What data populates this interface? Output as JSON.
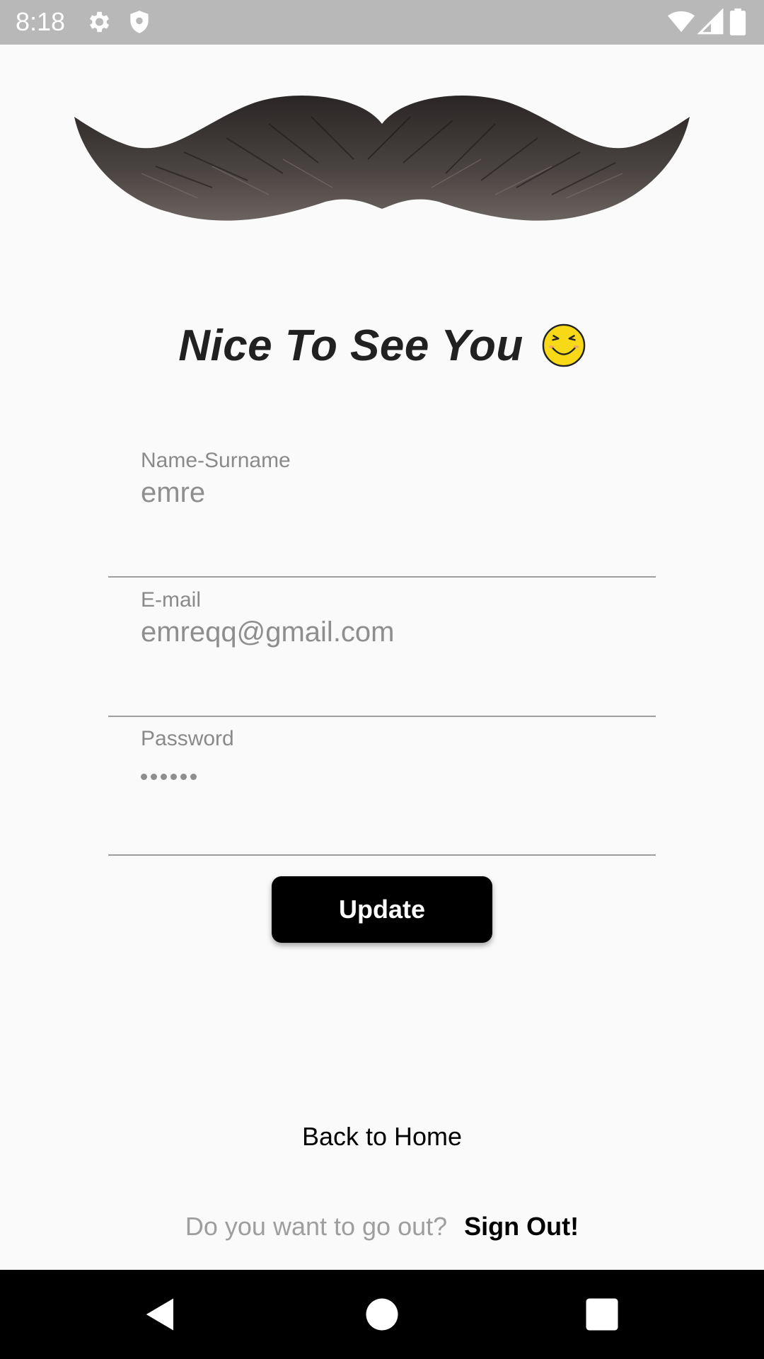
{
  "status_bar": {
    "time": "8:18",
    "icons": [
      "settings-icon",
      "shield-icon",
      "wifi-icon",
      "signal-icon",
      "battery-icon"
    ]
  },
  "header": {
    "title": "Nice To See You",
    "emoji_icon": "laughing-smiley-icon"
  },
  "form": {
    "name_label": "Name-Surname",
    "name_value": "emre",
    "email_label": "E-mail",
    "email_value": "emreqq@gmail.com",
    "password_label": "Password",
    "password_length": 6
  },
  "actions": {
    "update_label": "Update",
    "back_home_label": "Back to Home",
    "signout_question": "Do you want to go out?",
    "signout_label": "Sign Out!"
  },
  "nav_bar": {
    "buttons": [
      "back-icon",
      "home-icon",
      "recents-icon"
    ]
  },
  "colors": {
    "background": "#fafafa",
    "status_bar": "#b8b8b8",
    "button": "#000000",
    "divider": "#9e9e9e",
    "muted_text": "#8e8e8e"
  }
}
